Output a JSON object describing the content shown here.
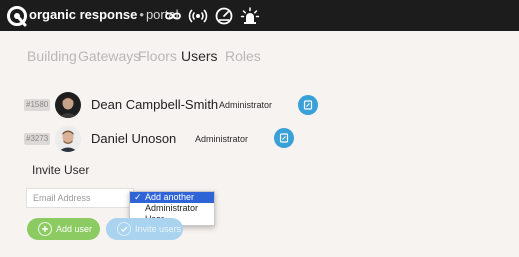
{
  "header": {
    "brand_bold": "organic response",
    "brand_separator": "•",
    "brand_light": "portal",
    "icons": [
      "logo-icon",
      "infinity-icon",
      "broadcast-icon",
      "gauge-icon",
      "alarm-icon"
    ]
  },
  "tabs": [
    {
      "label": "Building",
      "active": false
    },
    {
      "label": "Gateways",
      "active": false
    },
    {
      "label": "Floors",
      "active": false
    },
    {
      "label": "Users",
      "active": true
    },
    {
      "label": "Roles",
      "active": false
    }
  ],
  "users": [
    {
      "id": "#1580",
      "name": "Dean Campbell-Smith",
      "role": "Administrator"
    },
    {
      "id": "#3273",
      "name": "Daniel Unoson",
      "role": "Administrator"
    }
  ],
  "invite": {
    "title": "Invite User",
    "email_placeholder": "Email Address",
    "role_options": [
      "Add another",
      "Administrator",
      "User"
    ],
    "selected_option": "Add another",
    "check_mark": "✓",
    "add_button_label": "Add user",
    "invite_button_label": "Invite users"
  },
  "colors": {
    "topbar": "#1c1c1c",
    "accent_blue": "#3aa0d8",
    "add_green": "#8ccb61",
    "invite_disabled": "#a9d3ee",
    "dropdown_selected": "#2f64d6"
  }
}
